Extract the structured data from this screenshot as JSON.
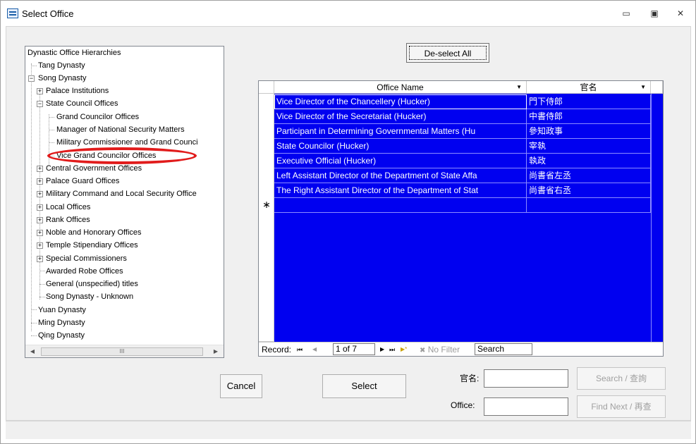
{
  "window": {
    "title": "Select Office",
    "min": "▭",
    "max": "▣",
    "close": "✕"
  },
  "tree": {
    "root": "Dynastic Office Hierarchies",
    "nodes": [
      {
        "label": "Tang Dynasty"
      },
      {
        "label": "Song Dynasty"
      },
      {
        "label": "Palace Institutions"
      },
      {
        "label": "State Council Offices"
      },
      {
        "label": "Grand Councilor Offices"
      },
      {
        "label": "Manager of National Security Matters"
      },
      {
        "label": "Military Commissioner and Grand Counci"
      },
      {
        "label": "Vice Grand Councilor Offices"
      },
      {
        "label": "Central Government Offices"
      },
      {
        "label": "Palace Guard Offices"
      },
      {
        "label": "Military Command and Local Security Office"
      },
      {
        "label": "Local Offices"
      },
      {
        "label": "Rank Offices"
      },
      {
        "label": "Noble and Honorary Offices"
      },
      {
        "label": "Temple Stipendiary Offices"
      },
      {
        "label": "Special Commissioners"
      },
      {
        "label": "Awarded Robe Offices"
      },
      {
        "label": "General (unspecified) titles"
      },
      {
        "label": "Song Dynasty - Unknown"
      },
      {
        "label": "Yuan Dynasty"
      },
      {
        "label": "Ming Dynasty"
      },
      {
        "label": "Qing Dynasty"
      }
    ],
    "scroll_thumb": "III"
  },
  "deselect_label": "De-select All",
  "grid": {
    "col_office": "Office Name",
    "col_chinese": "官名",
    "rows": [
      {
        "office": "Vice Director of the Chancellery (Hucker)",
        "chinese": "門下侍郎"
      },
      {
        "office": "Vice Director of the Secretariat (Hucker)",
        "chinese": "中書侍郎"
      },
      {
        "office": "Participant in Determining Governmental Matters  (Hu",
        "chinese": "參知政事"
      },
      {
        "office": "State Councilor (Hucker)",
        "chinese": "宰執"
      },
      {
        "office": "Executive Official (Hucker)",
        "chinese": "執政"
      },
      {
        "office": "Left Assistant Director of the Department of State Affa",
        "chinese": "尚書省左丞"
      },
      {
        "office": "The Right Assistant Director of the Department of Stat",
        "chinese": "尚書省右丞"
      }
    ],
    "new_row_marker": "∗"
  },
  "nav": {
    "record_label": "Record:",
    "first": "⏮",
    "prev": "◀",
    "current": "1 of 7",
    "next": "▶",
    "last": "⏭",
    "new": "▶*",
    "filter": "No Filter",
    "search": "Search"
  },
  "buttons": {
    "cancel": "Cancel",
    "select": "Select",
    "search": "Search / 查詢",
    "find_next": "Find Next / 再查"
  },
  "fields": {
    "chinese_label": "官名:",
    "office_label": "Office:"
  }
}
